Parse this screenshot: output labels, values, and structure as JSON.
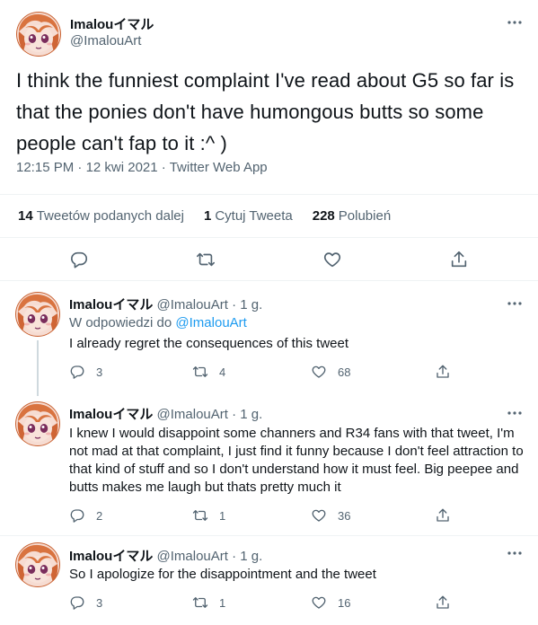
{
  "main_tweet": {
    "author_name": "Imalouイマル",
    "author_handle": "@ImalouArt",
    "text": "I think the funniest complaint I've read about G5 so far is that the ponies don't have humongous butts so some people can't fap to it :^ )",
    "time": "12:15 PM",
    "date": "12 kwi 2021",
    "source": "Twitter Web App",
    "separator": "·",
    "stats": {
      "retweets_count": "14",
      "retweets_label": "Tweetów podanych dalej",
      "quotes_count": "1",
      "quotes_label": "Cytuj Tweeta",
      "likes_count": "228",
      "likes_label": "Polubień"
    },
    "actions": [
      "reply-icon",
      "retweet-icon",
      "like-icon",
      "share-icon"
    ]
  },
  "replies": [
    {
      "author_name": "Imalouイマル",
      "author_handle": "@ImalouArt",
      "age": "1 g.",
      "replying_prefix": "W odpowiedzi do",
      "replying_to": "@ImalouArt",
      "text": "I already regret the consequences of this tweet",
      "reply_count": "3",
      "retweet_count": "4",
      "like_count": "68"
    },
    {
      "author_name": "Imalouイマル",
      "author_handle": "@ImalouArt",
      "age": "1 g.",
      "text": "I knew I would disappoint some channers and R34 fans with that tweet, I'm not mad at that complaint, I just find it funny because I don't feel attraction to that kind of stuff and so I don't understand how it must feel. Big peepee and butts makes me laugh but thats pretty much it",
      "reply_count": "2",
      "retweet_count": "1",
      "like_count": "36"
    },
    {
      "author_name": "Imalouイマル",
      "author_handle": "@ImalouArt",
      "age": "1 g.",
      "text": "So I apologize for the disappointment and the tweet",
      "reply_count": "3",
      "retweet_count": "1",
      "like_count": "16"
    }
  ],
  "colors": {
    "text": "#0f1419",
    "muted": "#536471",
    "link": "#1d9bf0",
    "divider": "#eff3f4"
  }
}
